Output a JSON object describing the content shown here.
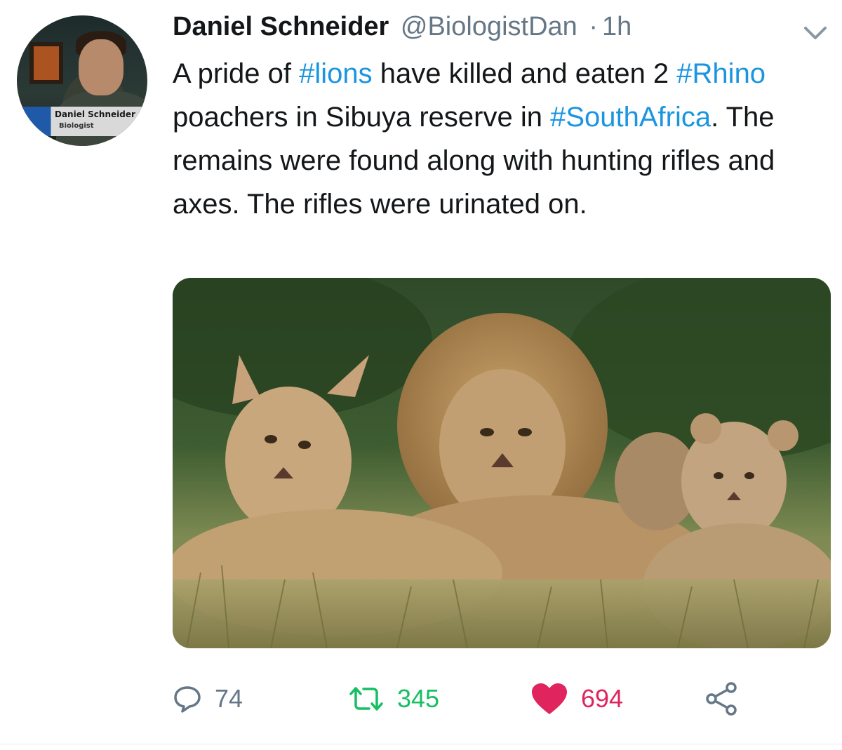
{
  "avatar": {
    "caption_name": "Daniel Schneider",
    "caption_role": "Biologist"
  },
  "tweet": {
    "author_name": "Daniel Schneider",
    "handle": "@BiologistDan",
    "separator": "·",
    "time": "1h",
    "text_parts": {
      "p1": "A pride of ",
      "h1": "#lions",
      "p2": " have killed and eaten 2 ",
      "h2": "#Rhino",
      "p3": " poachers in Sibuya reserve in ",
      "h3": "#SouthAfrica",
      "p4": ". The remains were found along with hunting rifles and axes. The rifles were urinated on."
    },
    "hashtag_color": "#1b95e0",
    "menu_icon": "chevron-down-icon",
    "media_description_icon": "photo"
  },
  "actions": {
    "reply": {
      "icon": "reply-icon",
      "count": "74"
    },
    "retweet": {
      "icon": "retweet-icon",
      "count": "345",
      "color": "#17bf63"
    },
    "like": {
      "icon": "heart-icon",
      "count": "694",
      "color": "#e0245e"
    },
    "share": {
      "icon": "share-icon"
    }
  }
}
